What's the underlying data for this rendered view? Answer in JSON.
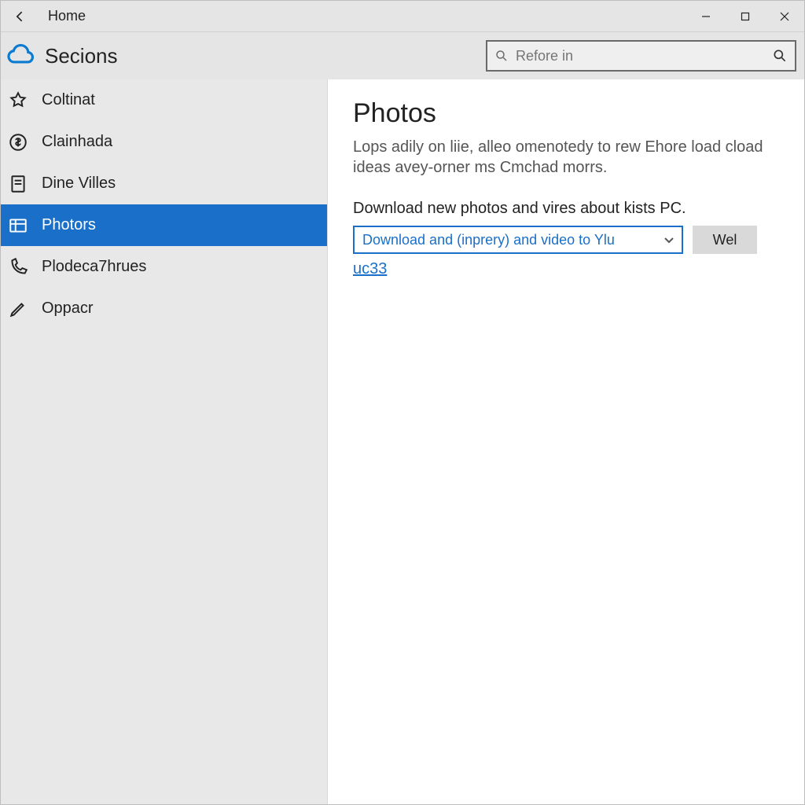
{
  "titlebar": {
    "title": "Home"
  },
  "header": {
    "app_title": "Secions"
  },
  "search": {
    "placeholder": "Refore in"
  },
  "sidebar": {
    "items": [
      {
        "label": "Coltinat"
      },
      {
        "label": "Clainhada"
      },
      {
        "label": "Dine Villes"
      },
      {
        "label": "Photors"
      },
      {
        "label": "Plodeca7hrues"
      },
      {
        "label": "Oppacr"
      }
    ]
  },
  "main": {
    "heading": "Photos",
    "description": "Lops adily on liie, alleo omenotedy to rew Ehore load cload ideas avey-orner ms Cmchad morrs.",
    "section_label": "Download new photos and vires about kists PC.",
    "dropdown_value": "Download and (inprery) and video to Ylu",
    "button_label": "Wel",
    "link_text": "uc33"
  }
}
